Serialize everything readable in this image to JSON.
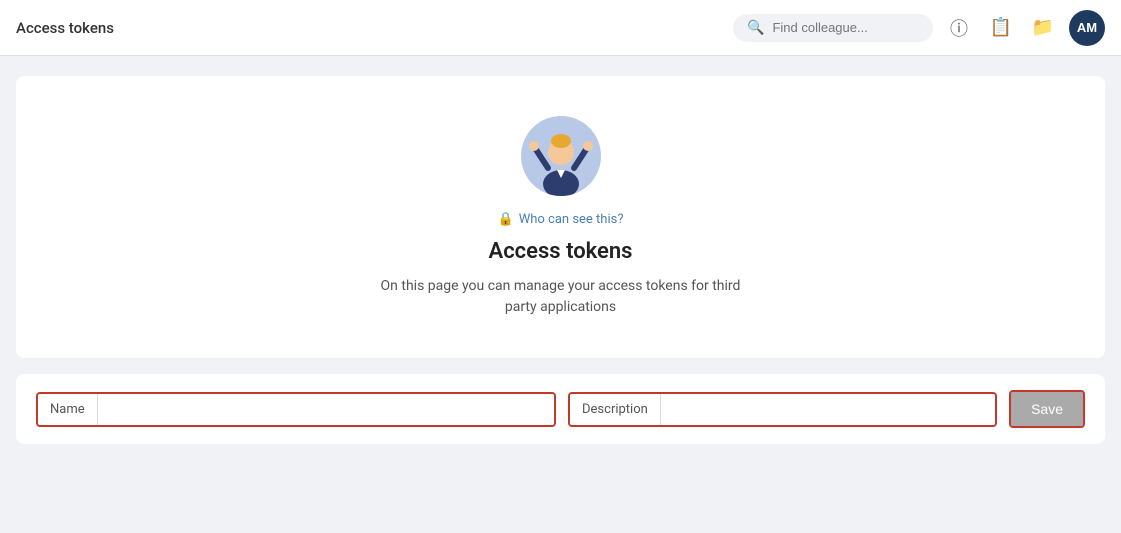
{
  "header": {
    "title": "Access tokens",
    "search_placeholder": "Find colleague...",
    "avatar_initials": "AM"
  },
  "card": {
    "privacy_text": "Who can see this?",
    "title": "Access tokens",
    "description": "On this page you can manage your access tokens for third party applications"
  },
  "form": {
    "name_label": "Name",
    "description_label": "Description",
    "save_label": "Save"
  }
}
